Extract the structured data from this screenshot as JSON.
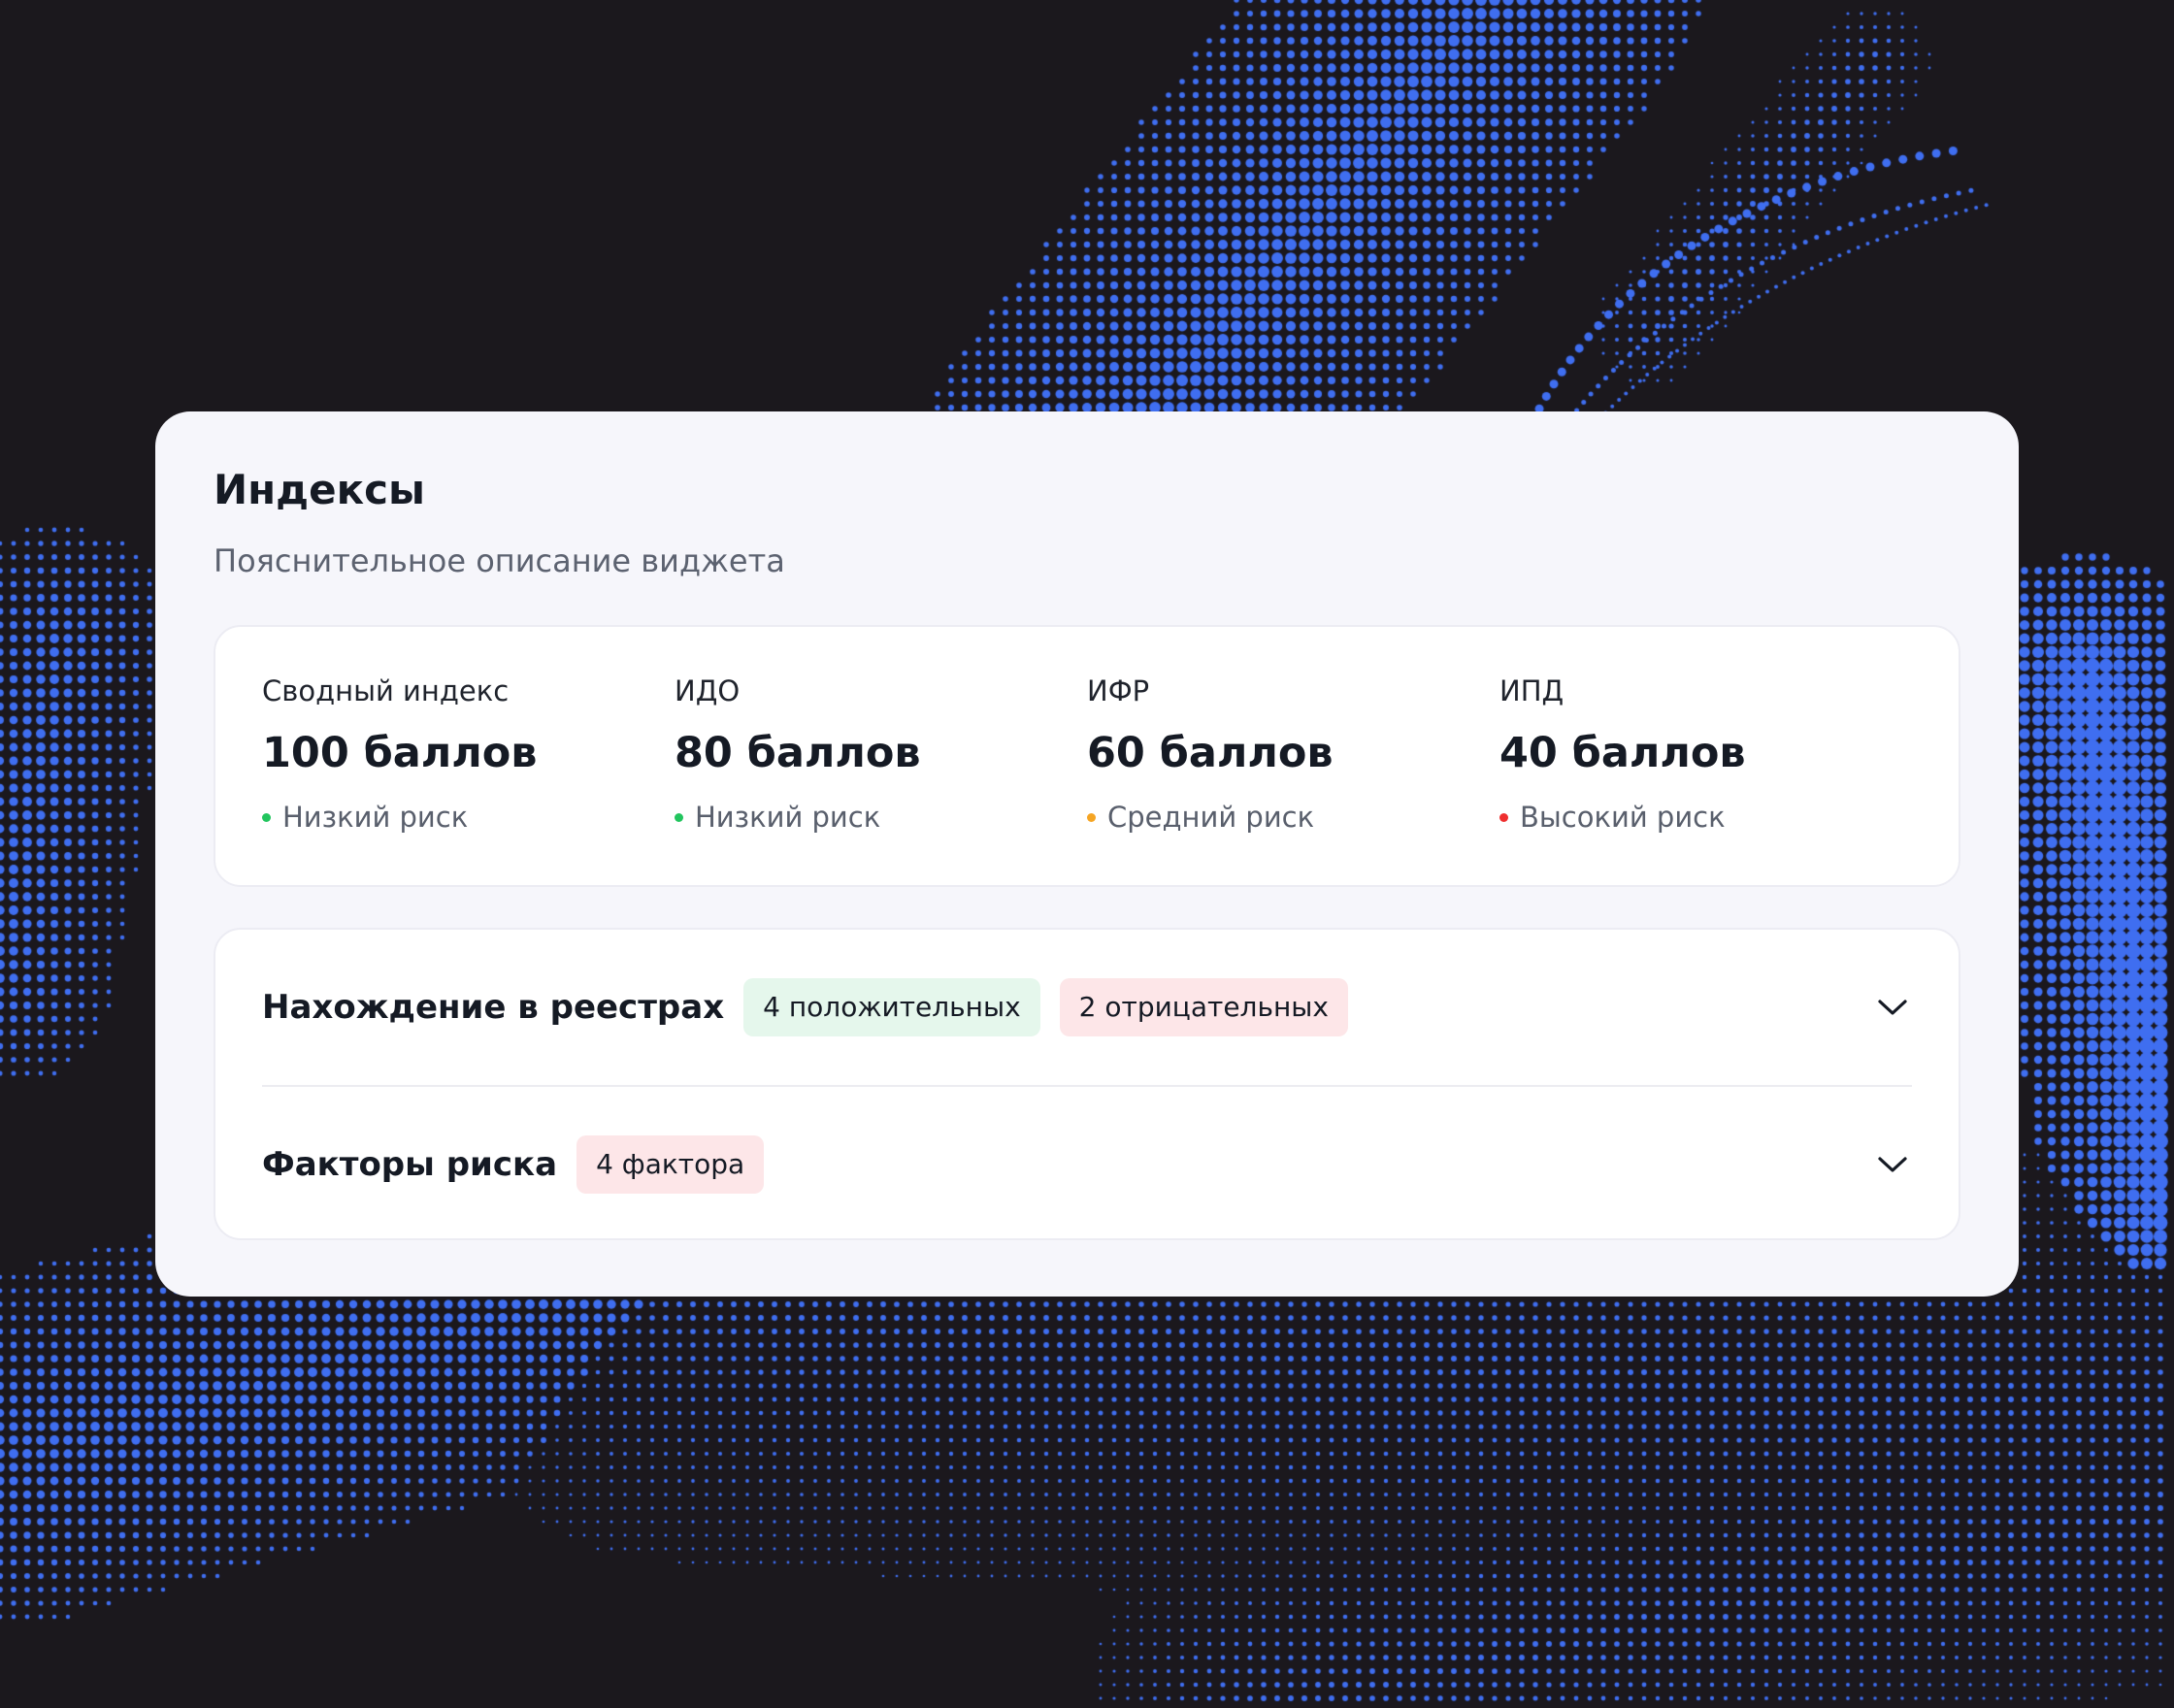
{
  "widget": {
    "title": "Индексы",
    "subtitle": "Пояснительное описание виджета"
  },
  "indices": [
    {
      "label": "Сводный индекс",
      "value": "100 баллов",
      "risk": "Низкий риск",
      "risk_color": "#22c55e"
    },
    {
      "label": "ИДО",
      "value": "80 баллов",
      "risk": "Низкий риск",
      "risk_color": "#22c55e"
    },
    {
      "label": "ИФР",
      "value": "60 баллов",
      "risk": "Средний риск",
      "risk_color": "#f5a524"
    },
    {
      "label": "ИПД",
      "value": "40 баллов",
      "risk": "Высокий риск",
      "risk_color": "#ef2f2f"
    }
  ],
  "sections": [
    {
      "title": "Нахождение в реестрах",
      "badges": [
        {
          "text": "4 положительных",
          "kind": "positive"
        },
        {
          "text": "2 отрицательных",
          "kind": "negative"
        }
      ],
      "icon": "chevron-down-icon"
    },
    {
      "title": "Факторы риска",
      "badges": [
        {
          "text": "4 фактора",
          "kind": "negative"
        }
      ],
      "icon": "chevron-down-icon"
    }
  ],
  "colors": {
    "background": "#1b181d",
    "dots": "#3f6ef0",
    "card": "#f6f6fb",
    "positive_badge": "#e5f7ec",
    "negative_badge": "#fde6e8"
  }
}
